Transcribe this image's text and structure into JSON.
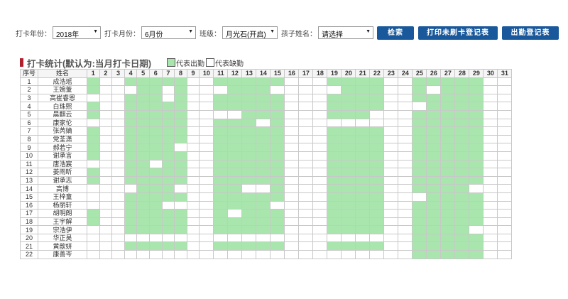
{
  "filters": {
    "year_label": "打卡年份：",
    "year_value": "2018年",
    "month_label": "打卡月份：",
    "month_value": "6月份",
    "class_label": "班级：",
    "class_value": "月光石(开启)",
    "child_label": "孩子姓名：",
    "child_value": "请选择"
  },
  "buttons": {
    "search": "检索",
    "print_unswiped": "打印未刷卡登记表",
    "attendance": "出勤登记表"
  },
  "stats": {
    "title": "打卡统计(默认为:当月打卡日期)",
    "legend_present": "代表出勤",
    "legend_absent": "代表缺勤"
  },
  "colors": {
    "present": "#a8e6ad",
    "absent": "#ffffff",
    "button": "#19589a",
    "title_mark": "#b0202c"
  },
  "table": {
    "idx_header": "序号",
    "name_header": "姓名",
    "days": [
      "1",
      "2",
      "3",
      "4",
      "5",
      "6",
      "7",
      "8",
      "9",
      "10",
      "11",
      "12",
      "13",
      "14",
      "15",
      "16",
      "17",
      "18",
      "19",
      "20",
      "21",
      "22",
      "23",
      "24",
      "25",
      "26",
      "27",
      "28",
      "29",
      "30",
      "31"
    ],
    "rows": [
      {
        "idx": "1",
        "name": "成浩瑶",
        "present": [
          1,
          4,
          5,
          6,
          7,
          8,
          11,
          12,
          13,
          14,
          15,
          19,
          20,
          21,
          22,
          25,
          26,
          27,
          28,
          29
        ]
      },
      {
        "idx": "2",
        "name": "王婉董",
        "present": [
          1,
          5,
          6,
          8,
          12,
          13,
          14,
          20,
          21,
          22,
          25,
          27,
          28,
          29
        ]
      },
      {
        "idx": "3",
        "name": "高崔睿恩",
        "present": [
          4,
          5,
          6,
          8,
          11,
          12,
          13,
          14,
          15,
          19,
          20,
          21,
          22,
          25,
          26,
          27,
          28,
          29
        ]
      },
      {
        "idx": "4",
        "name": "白珠熙",
        "present": [
          1,
          4,
          5,
          6,
          7,
          8,
          11,
          12,
          13,
          14,
          15,
          19,
          20,
          21,
          22,
          26,
          27,
          28,
          29
        ]
      },
      {
        "idx": "5",
        "name": "晨麒云",
        "present": [
          1,
          4,
          5,
          6,
          7,
          8,
          13,
          14,
          15,
          19,
          20,
          21,
          25,
          26,
          27,
          28,
          29
        ]
      },
      {
        "idx": "6",
        "name": "康家伦",
        "present": [
          4,
          5,
          6,
          7,
          8,
          11,
          12,
          13,
          15,
          25,
          26,
          27,
          28,
          29
        ]
      },
      {
        "idx": "7",
        "name": "张芮嫡",
        "present": [
          1,
          4,
          5,
          6,
          7,
          8,
          11,
          12,
          13,
          14,
          15,
          19,
          20,
          21,
          22,
          25,
          26,
          27,
          28,
          29
        ]
      },
      {
        "idx": "8",
        "name": "党荃潇",
        "present": [
          1,
          4,
          5,
          6,
          7,
          8,
          11,
          12,
          13,
          14,
          15,
          19,
          20,
          21,
          22,
          25,
          26,
          27,
          28,
          29
        ]
      },
      {
        "idx": "9",
        "name": "郝若宁",
        "present": [
          1,
          4,
          5,
          6,
          7,
          11,
          12,
          13,
          14,
          15,
          19,
          20,
          21,
          22,
          25,
          26,
          27,
          28,
          29
        ]
      },
      {
        "idx": "10",
        "name": "谢承言",
        "present": [
          1,
          4,
          5,
          6,
          7,
          8,
          11,
          12,
          13,
          14,
          15,
          19,
          20,
          21,
          22,
          25,
          26,
          27,
          28,
          29
        ]
      },
      {
        "idx": "11",
        "name": "唐浩宸",
        "present": [
          4,
          5,
          7,
          8,
          11,
          12,
          13,
          14,
          15,
          19,
          20,
          21,
          22,
          25,
          26,
          27,
          28,
          29
        ]
      },
      {
        "idx": "12",
        "name": "姜雨昕",
        "present": [
          1,
          4,
          5,
          6,
          7,
          8,
          11,
          12,
          13,
          14,
          15,
          19,
          20,
          21,
          22,
          25,
          26,
          27,
          28,
          29
        ]
      },
      {
        "idx": "13",
        "name": "谢承志",
        "present": [
          1,
          4,
          5,
          6,
          7,
          8,
          11,
          12,
          13,
          14,
          15,
          19,
          20,
          21,
          22,
          25,
          26,
          27,
          28,
          29
        ]
      },
      {
        "idx": "14",
        "name": "高博",
        "present": [
          5,
          6,
          7,
          11,
          12,
          15,
          19,
          20,
          21,
          22,
          25,
          26,
          27,
          28
        ]
      },
      {
        "idx": "15",
        "name": "王梓童",
        "present": [
          4,
          5,
          6,
          7,
          8,
          11,
          12,
          13,
          14,
          15,
          19,
          20,
          21,
          22,
          26,
          27,
          28,
          29
        ]
      },
      {
        "idx": "16",
        "name": "杨丽轩",
        "present": [
          4,
          5,
          6,
          11,
          12,
          13,
          14,
          19,
          20,
          21,
          22,
          25,
          26,
          27,
          28,
          29
        ]
      },
      {
        "idx": "17",
        "name": "胡明朗",
        "present": [
          1,
          4,
          5,
          6,
          7,
          8,
          11,
          13,
          14,
          15,
          19,
          20,
          21,
          22,
          25,
          26,
          27,
          28,
          29
        ]
      },
      {
        "idx": "18",
        "name": "王宇解",
        "present": [
          1,
          4,
          5,
          6,
          7,
          8,
          11,
          12,
          13,
          14,
          15,
          19,
          20,
          21,
          22,
          25,
          26,
          27,
          28,
          29
        ]
      },
      {
        "idx": "19",
        "name": "宗浩伊",
        "present": [
          4,
          5,
          6,
          7,
          8,
          11,
          12,
          13,
          14,
          15,
          19,
          20,
          21,
          22,
          25,
          26,
          27,
          28
        ]
      },
      {
        "idx": "20",
        "name": "华正昊",
        "present": [
          25,
          26,
          27,
          28,
          29
        ]
      },
      {
        "idx": "21",
        "name": "黄歆妍",
        "present": [
          4,
          5,
          6,
          7,
          8,
          11,
          12,
          13,
          14,
          15,
          19,
          20,
          21,
          22,
          25,
          26,
          27,
          28,
          29
        ]
      },
      {
        "idx": "22",
        "name": "康善岑",
        "present": [
          25,
          26,
          27,
          28,
          29
        ]
      }
    ]
  }
}
